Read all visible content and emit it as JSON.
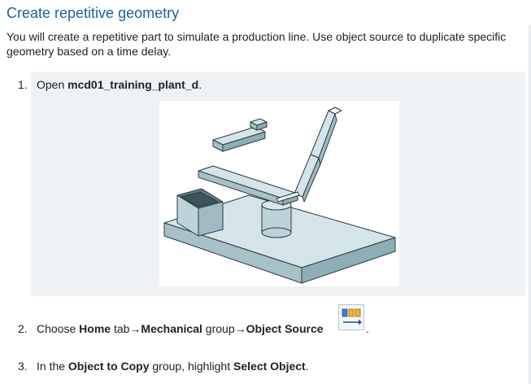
{
  "page": {
    "title": "Create repetitive geometry",
    "intro": "You will create a repetitive part to simulate a production line. Use object source to duplicate specific geometry based on a time delay."
  },
  "steps": [
    {
      "number": "1.",
      "prefix": "Open ",
      "file": "mcd01_training_plant_d",
      "suffix": "."
    },
    {
      "number": "2.",
      "prefix": "Choose ",
      "home": "Home",
      "tab_text": " tab→",
      "mechanical": "Mechanical",
      "group_text": " group→",
      "object_source": "Object Source",
      "suffix": "."
    },
    {
      "number": "3.",
      "prefix": "In the ",
      "object_to_copy": "Object to Copy",
      "middle": " group, highlight ",
      "select_object": "Select Object",
      "suffix": "."
    }
  ],
  "icons": {
    "object_source": "object-source-icon"
  },
  "colors": {
    "title": "#1f5fa0",
    "panel": "#eef2f4",
    "model": "#c9dde3",
    "model_edge": "#2c3a40"
  }
}
